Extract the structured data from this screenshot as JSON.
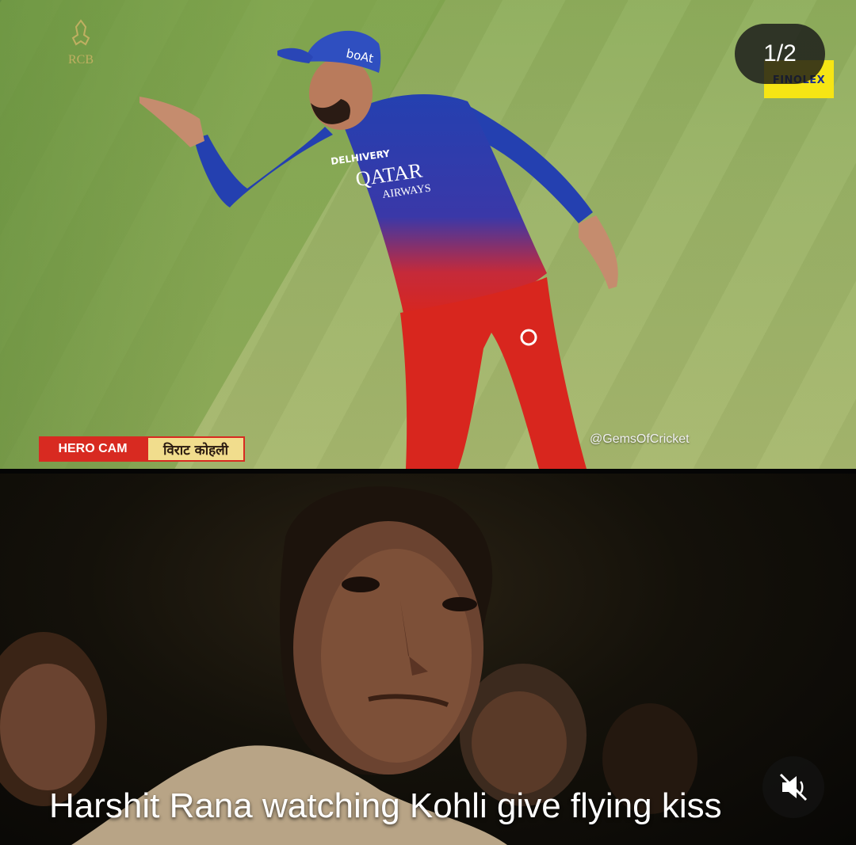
{
  "post": {
    "page_indicator": "1/2",
    "top_image": {
      "broadcast_tag": "HERO CAM",
      "player_name_tag": "विराट कोहली",
      "watermark": "@GemsOfCricket",
      "board_text": "FINOLEX",
      "cap_text": "boAt",
      "jersey_sponsor_top": "DELHIVERY",
      "jersey_sponsor_main": "QATAR",
      "jersey_sponsor_sub": "AIRWAYS",
      "colors": {
        "grass": "#9ab366",
        "jersey_blue": "#2440b0",
        "kit_red": "#d8261e",
        "tag_red": "#d82a21",
        "tag_gold": "#f1dd8d"
      }
    },
    "bottom_image": {
      "caption": "Harshit Rana watching Kohli give flying kiss"
    },
    "mute_icon": "speaker-muted-icon"
  }
}
